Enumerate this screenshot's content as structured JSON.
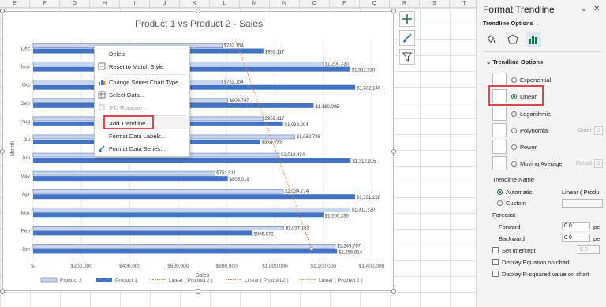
{
  "sheet": {
    "columns": [
      "E",
      "F",
      "G",
      "H",
      "I",
      "J",
      "K",
      "L",
      "M",
      "N",
      "O",
      "P",
      "Q",
      "R",
      "S",
      "T"
    ]
  },
  "chart": {
    "context_menu": {
      "items": [
        {
          "label": "Delete",
          "icon": "none",
          "disabled": false
        },
        {
          "label": "Reset to Match Style",
          "icon": "reset-style-icon",
          "disabled": false
        },
        {
          "label": "Change Series Chart Type...",
          "icon": "chart-type-icon",
          "disabled": false
        },
        {
          "label": "Select Data...",
          "icon": "select-data-icon",
          "disabled": false
        },
        {
          "label": "3-D Rotation...",
          "icon": "rotation-3d-icon",
          "disabled": true
        },
        {
          "label": "Add Trendline...",
          "icon": "none",
          "disabled": false
        },
        {
          "label": "Format Data Labels...",
          "icon": "none",
          "disabled": false
        },
        {
          "label": "Format Data Series...",
          "icon": "format-series-icon",
          "disabled": false
        }
      ]
    },
    "side_buttons": [
      "chart-elements-plus-icon",
      "chart-styles-brush-icon",
      "chart-filters-icon"
    ]
  },
  "chart_data": {
    "type": "bar",
    "orientation": "horizontal",
    "title": "Product 1 vs Product 2 - Sales",
    "xlabel": "Sales",
    "ylabel": "Month",
    "categories": [
      "Jan",
      "Feb",
      "Mar",
      "Apr",
      "May",
      "Jun",
      "Jul",
      "Aug",
      "Sep",
      "Oct",
      "Nov",
      "Dec"
    ],
    "series": [
      {
        "name": "Product 2",
        "color": "#c9d6ee",
        "values": [
          1249787,
          1037133,
          1311220,
          1034774,
          751511,
          1018434,
          1082736,
          952117,
          804747,
          782154,
          1200230,
          782154
        ]
      },
      {
        "name": "Product 1",
        "color": "#4472c4",
        "values": [
          1256614,
          905672,
          1200230,
          1331238,
          805019,
          1312915,
          939273,
          1033294,
          1160005,
          1332146,
          1311220,
          952117
        ]
      }
    ],
    "value_labels": {
      "Product 2": [
        "$1,249,787",
        "$1,037,133",
        "$1,311,220",
        "$1,034,774",
        "$751,511",
        "$1,018,434",
        "$1,082,736",
        "$952,117",
        "$804,747",
        "$782,154",
        "$1,200,230",
        "$782,154"
      ],
      "Product 1": [
        "$1,256,614",
        "$905,672",
        "$1,200,230",
        "$1,331,238",
        "$805,019",
        "$1,312,915",
        "$939,273",
        "$1,033,294",
        "$1,160,005",
        "$1,332,146",
        "$1,311,220",
        "$952,117"
      ]
    },
    "trendline": {
      "series": "Product 2",
      "type": "linear",
      "color": "#ed7d31",
      "style": "dotted"
    },
    "xlim": [
      0,
      1400000
    ],
    "xticks": [
      "$-",
      "$200,000",
      "$400,000",
      "$600,000",
      "$800,000",
      "$1,000,000",
      "$1,200,000",
      "$1,400,000"
    ],
    "legend": [
      "Product 2",
      "Product 1",
      "Linear ( Product 2 )",
      "Linear ( Product 2 )",
      "Linear ( Product 2 )"
    ],
    "legend_position": "bottom",
    "grid": true
  },
  "pane": {
    "title": "Format Trendline",
    "tab": "Trendline Options",
    "section": "Trendline Options",
    "types": [
      {
        "label": "Exponential",
        "selected": false,
        "extra": "",
        "extra_value": ""
      },
      {
        "label": "Linear",
        "selected": true,
        "extra": "",
        "extra_value": ""
      },
      {
        "label": "Logarithmic",
        "selected": false,
        "extra": "",
        "extra_value": ""
      },
      {
        "label": "Polynomial",
        "selected": false,
        "extra": "Order",
        "extra_value": "2"
      },
      {
        "label": "Power",
        "selected": false,
        "extra": "",
        "extra_value": ""
      },
      {
        "label": "Moving Average",
        "selected": false,
        "extra": "Period",
        "extra_value": "2"
      }
    ],
    "name_label": "Trendline Name",
    "automatic_label": "Automatic",
    "automatic_value": "Linear ( Produ",
    "custom_label": "Custom",
    "forecast_label": "Forecast",
    "forward_label": "Forward",
    "forward_value": "0.0",
    "backward_label": "Backward",
    "backward_value": "0.0",
    "period_unit": "pe",
    "set_intercept_label": "Set Intercept",
    "intercept_value": "0.0",
    "display_equation_label": "Display Equation on chart",
    "display_rsq_label": "Display R-squared value on chart"
  }
}
